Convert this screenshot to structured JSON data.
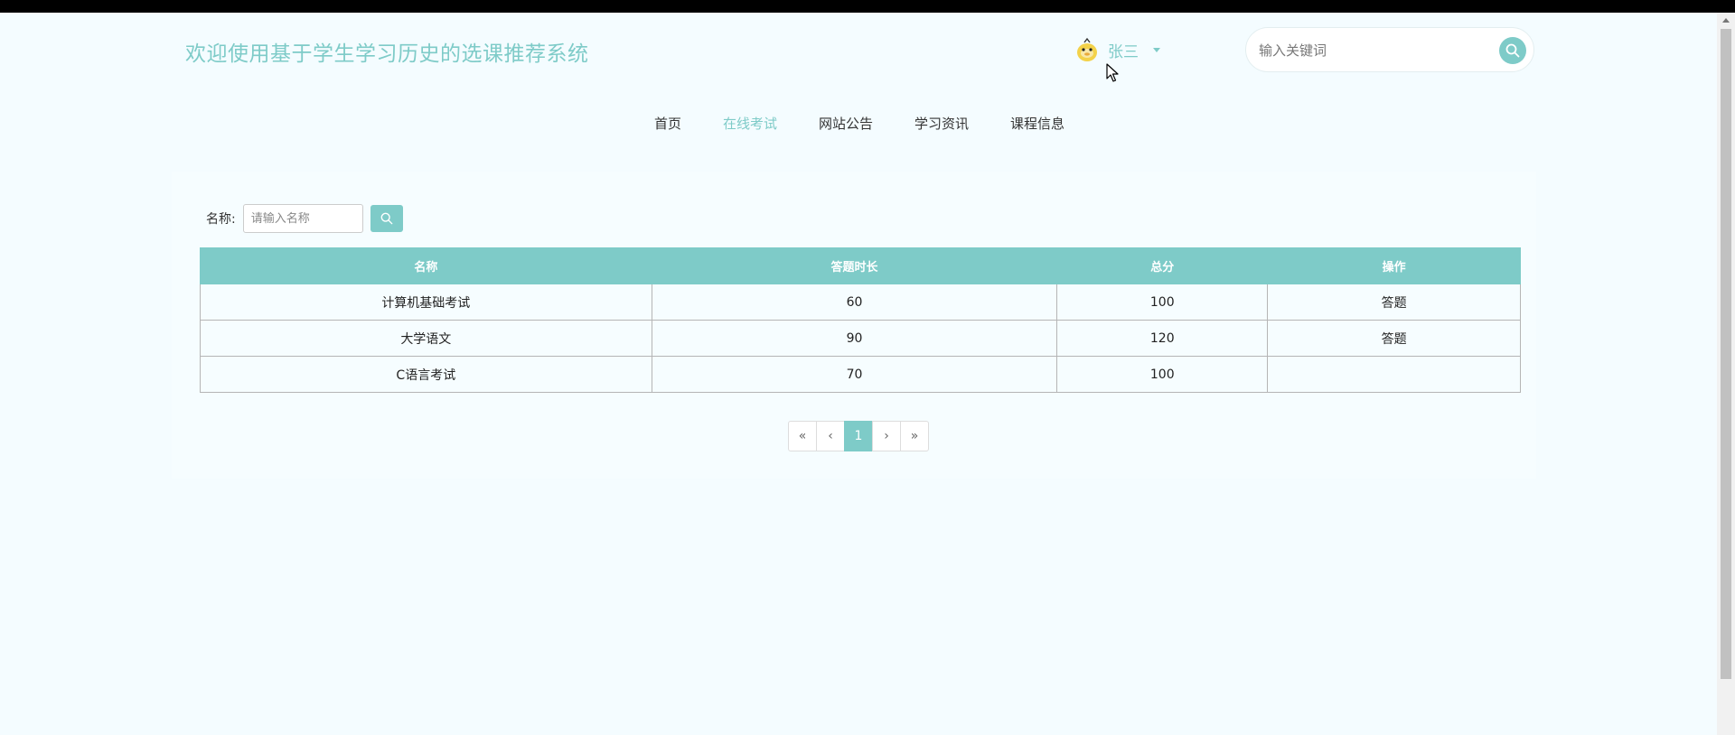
{
  "header": {
    "site_title": "欢迎使用基于学生学习历史的选课推荐系统",
    "username": "张三",
    "search_placeholder": "输入关键词"
  },
  "nav": [
    {
      "label": "首页",
      "active": false
    },
    {
      "label": "在线考试",
      "active": true
    },
    {
      "label": "网站公告",
      "active": false
    },
    {
      "label": "学习资讯",
      "active": false
    },
    {
      "label": "课程信息",
      "active": false
    }
  ],
  "filter": {
    "label": "名称:",
    "placeholder": "请输入名称"
  },
  "table": {
    "headers": [
      "名称",
      "答题时长",
      "总分",
      "操作"
    ],
    "rows": [
      {
        "name": "计算机基础考试",
        "duration": "60",
        "score": "100",
        "action": "答题"
      },
      {
        "name": "大学语文",
        "duration": "90",
        "score": "120",
        "action": "答题"
      },
      {
        "name": "C语言考试",
        "duration": "70",
        "score": "100",
        "action": ""
      }
    ]
  },
  "pagination": {
    "first": "«",
    "prev": "‹",
    "current": "1",
    "next": "›",
    "last": "»"
  },
  "colors": {
    "accent": "#7ecbc8",
    "background": "#f4fcff"
  }
}
